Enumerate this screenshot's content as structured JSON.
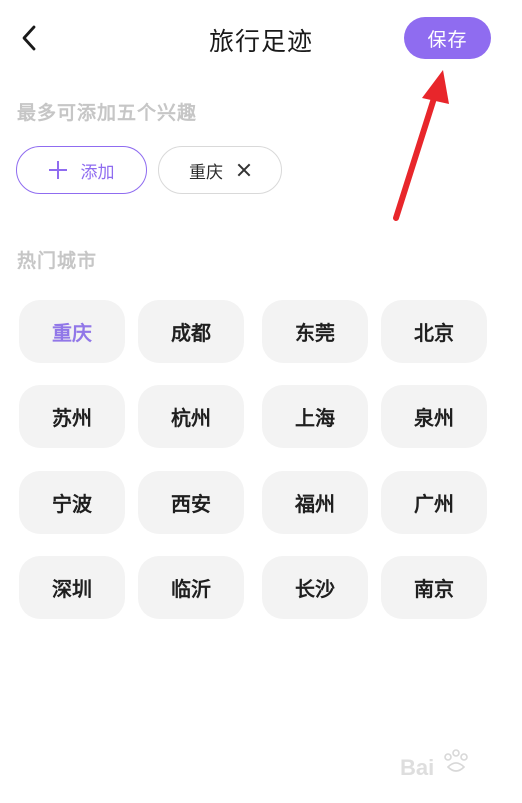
{
  "header": {
    "title": "旅行足迹",
    "save_label": "保存"
  },
  "hint_label": "最多可添加五个兴趣",
  "selected": {
    "add_label": "添加",
    "chips": [
      {
        "label": "重庆"
      }
    ]
  },
  "hot_cities": {
    "label": "热门城市",
    "items": [
      {
        "label": "重庆",
        "selected": true
      },
      {
        "label": "成都",
        "selected": false
      },
      {
        "label": "东莞",
        "selected": false
      },
      {
        "label": "北京",
        "selected": false
      },
      {
        "label": "苏州",
        "selected": false
      },
      {
        "label": "杭州",
        "selected": false
      },
      {
        "label": "上海",
        "selected": false
      },
      {
        "label": "泉州",
        "selected": false
      },
      {
        "label": "宁波",
        "selected": false
      },
      {
        "label": "西安",
        "selected": false
      },
      {
        "label": "福州",
        "selected": false
      },
      {
        "label": "广州",
        "selected": false
      },
      {
        "label": "深圳",
        "selected": false
      },
      {
        "label": "临沂",
        "selected": false
      },
      {
        "label": "长沙",
        "selected": false
      },
      {
        "label": "南京",
        "selected": false
      }
    ]
  },
  "colors": {
    "accent": "#8f6cf0",
    "annotation_arrow": "#e8262b",
    "chip_bg": "#f3f3f3"
  },
  "icons": {
    "back": "chevron-left-icon",
    "add": "plus-icon",
    "remove": "close-icon"
  }
}
